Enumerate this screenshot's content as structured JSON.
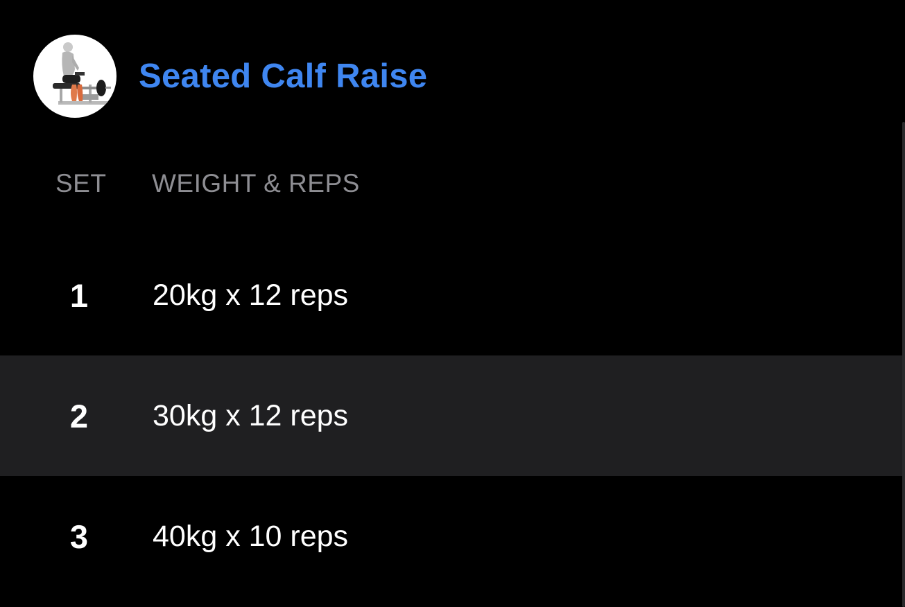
{
  "exercise": {
    "title": "Seated Calf Raise",
    "title_color": "#3f86f0",
    "thumbnail_icon": "seated-calf-raise-illustration"
  },
  "table": {
    "headers": {
      "set": "SET",
      "weight_reps": "WEIGHT & REPS"
    },
    "rows": [
      {
        "set": "1",
        "value": "20kg x 12 reps",
        "bg": "#000000"
      },
      {
        "set": "2",
        "value": "30kg x 12 reps",
        "bg": "#1f1f21"
      },
      {
        "set": "3",
        "value": "40kg x 10 reps",
        "bg": "#000000"
      }
    ]
  }
}
